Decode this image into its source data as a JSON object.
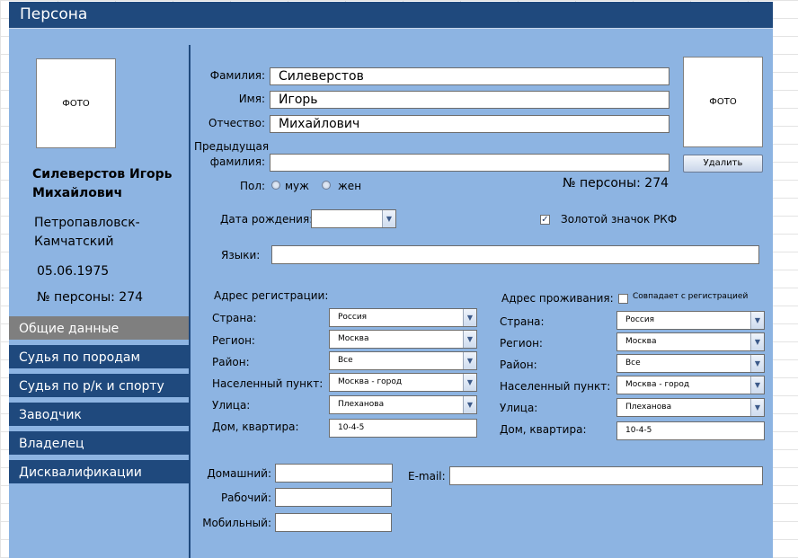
{
  "window": {
    "title": "Персона"
  },
  "left_panel": {
    "photo_label": "ФОТО",
    "full_name_line1": "Силеверстов Игорь",
    "full_name_line2": "Михайлович",
    "city_line1": "Петропавловск-",
    "city_line2": "Камчатский",
    "birth_date": "05.06.1975",
    "person_number": "№ персоны: 274"
  },
  "nav": {
    "items": [
      {
        "label": "Общие данные",
        "active": true
      },
      {
        "label": "Судья по породам",
        "active": false
      },
      {
        "label": "Судья по р/к и спорту",
        "active": false
      },
      {
        "label": "Заводчик",
        "active": false
      },
      {
        "label": "Владелец",
        "active": false
      },
      {
        "label": "Дисквалификации",
        "active": false
      }
    ]
  },
  "form": {
    "surname_label": "Фамилия:",
    "surname_value": "Силеверстов",
    "name_label": "Имя:",
    "name_value": "Игорь",
    "patronymic_label": "Отчество:",
    "patronymic_value": "Михайлович",
    "prev_surname_label_1": "Предыдущая",
    "prev_surname_label_2": "фамилия:",
    "prev_surname_value": "",
    "gender_label": "Пол:",
    "gender_male": "муж",
    "gender_female": "жен",
    "person_number": "№ персоны: 274",
    "photo_label": "ФОТО",
    "delete_button": "Удалить",
    "birth_label": "Дата рождения:",
    "birth_value": "",
    "gold_badge_label": "Золотой значок РКФ",
    "gold_badge_checked": true,
    "languages_label": "Языки:",
    "languages_value": ""
  },
  "reg_address": {
    "header": "Адрес регистрации:",
    "country_label": "Страна:",
    "country_value": "Россия",
    "region_label": "Регион:",
    "region_value": "Москва",
    "district_label": "Район:",
    "district_value": "Все",
    "locality_label": "Населенный пункт:",
    "locality_value": "Москва - город",
    "street_label": "Улица:",
    "street_value": "Плеханова",
    "house_label": "Дом, квартира:",
    "house_value": "10-4-5"
  },
  "live_address": {
    "header": "Адрес проживания:",
    "same_label": "Совпадает с регистрацией",
    "same_checked": false,
    "country_label": "Страна:",
    "country_value": "Россия",
    "region_label": "Регион:",
    "region_value": "Москва",
    "district_label": "Район:",
    "district_value": "Все",
    "locality_label": "Населенный пункт:",
    "locality_value": "Москва - город",
    "street_label": "Улица:",
    "street_value": "Плеханова",
    "house_label": "Дом, квартира:",
    "house_value": "10-4-5"
  },
  "contacts": {
    "home_label": "Домашний:",
    "home_value": "",
    "work_label": "Рабочий:",
    "work_value": "",
    "mobile_label": "Мобильный:",
    "mobile_value": "",
    "email_label": "E-mail:",
    "email_value": ""
  },
  "colors": {
    "accent": "#1f497d",
    "form_bg": "#8db4e2",
    "active_nav": "#7f7f7f"
  },
  "icons": {
    "dropdown": "chevron-down-icon",
    "radio": "radio-icon",
    "checkbox": "checkbox-icon"
  }
}
